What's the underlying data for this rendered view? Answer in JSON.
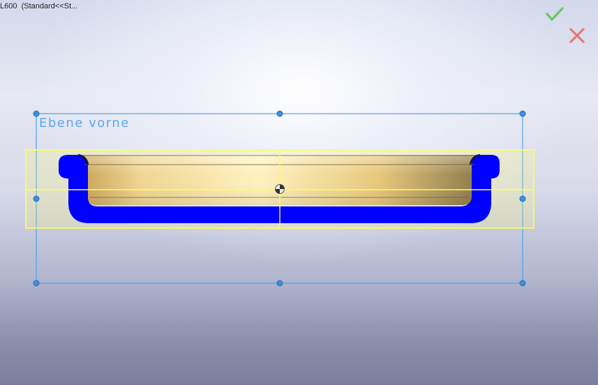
{
  "window": {
    "title": "L600  (Standard<<St..."
  },
  "confirm_corner": {
    "ok_icon": "check-icon",
    "cancel_icon": "close-icon",
    "ok_color": "#7fcf7f",
    "cancel_color": "#e07a7a"
  },
  "plane": {
    "label": "Ebene vorne",
    "color": "#4da3ea"
  },
  "part": {
    "section_color": "#0000ff",
    "face_color": "#e9c77f",
    "highlight_color": "#ffff66"
  }
}
